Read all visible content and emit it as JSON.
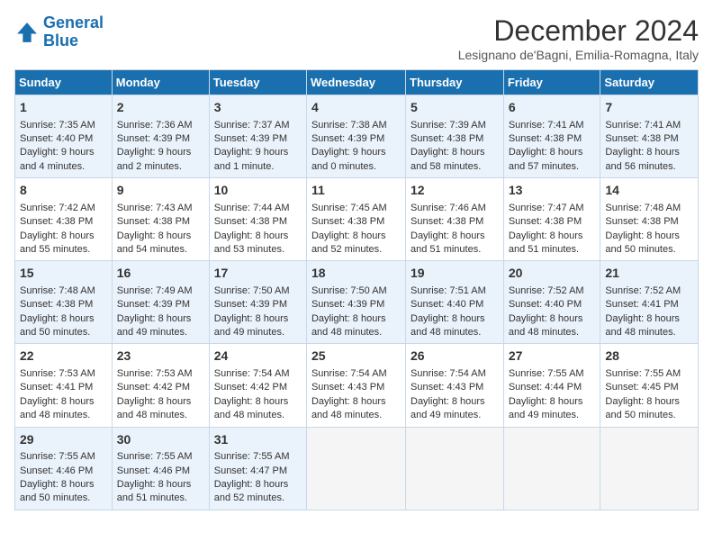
{
  "logo": {
    "line1": "General",
    "line2": "Blue"
  },
  "title": "December 2024",
  "subtitle": "Lesignano de'Bagni, Emilia-Romagna, Italy",
  "days_of_week": [
    "Sunday",
    "Monday",
    "Tuesday",
    "Wednesday",
    "Thursday",
    "Friday",
    "Saturday"
  ],
  "weeks": [
    [
      {
        "day": "1",
        "sunrise": "7:35 AM",
        "sunset": "4:40 PM",
        "daylight": "9 hours and 4 minutes."
      },
      {
        "day": "2",
        "sunrise": "7:36 AM",
        "sunset": "4:39 PM",
        "daylight": "9 hours and 2 minutes."
      },
      {
        "day": "3",
        "sunrise": "7:37 AM",
        "sunset": "4:39 PM",
        "daylight": "9 hours and 1 minute."
      },
      {
        "day": "4",
        "sunrise": "7:38 AM",
        "sunset": "4:39 PM",
        "daylight": "9 hours and 0 minutes."
      },
      {
        "day": "5",
        "sunrise": "7:39 AM",
        "sunset": "4:38 PM",
        "daylight": "8 hours and 58 minutes."
      },
      {
        "day": "6",
        "sunrise": "7:41 AM",
        "sunset": "4:38 PM",
        "daylight": "8 hours and 57 minutes."
      },
      {
        "day": "7",
        "sunrise": "7:41 AM",
        "sunset": "4:38 PM",
        "daylight": "8 hours and 56 minutes."
      }
    ],
    [
      {
        "day": "8",
        "sunrise": "7:42 AM",
        "sunset": "4:38 PM",
        "daylight": "8 hours and 55 minutes."
      },
      {
        "day": "9",
        "sunrise": "7:43 AM",
        "sunset": "4:38 PM",
        "daylight": "8 hours and 54 minutes."
      },
      {
        "day": "10",
        "sunrise": "7:44 AM",
        "sunset": "4:38 PM",
        "daylight": "8 hours and 53 minutes."
      },
      {
        "day": "11",
        "sunrise": "7:45 AM",
        "sunset": "4:38 PM",
        "daylight": "8 hours and 52 minutes."
      },
      {
        "day": "12",
        "sunrise": "7:46 AM",
        "sunset": "4:38 PM",
        "daylight": "8 hours and 51 minutes."
      },
      {
        "day": "13",
        "sunrise": "7:47 AM",
        "sunset": "4:38 PM",
        "daylight": "8 hours and 51 minutes."
      },
      {
        "day": "14",
        "sunrise": "7:48 AM",
        "sunset": "4:38 PM",
        "daylight": "8 hours and 50 minutes."
      }
    ],
    [
      {
        "day": "15",
        "sunrise": "7:48 AM",
        "sunset": "4:38 PM",
        "daylight": "8 hours and 50 minutes."
      },
      {
        "day": "16",
        "sunrise": "7:49 AM",
        "sunset": "4:39 PM",
        "daylight": "8 hours and 49 minutes."
      },
      {
        "day": "17",
        "sunrise": "7:50 AM",
        "sunset": "4:39 PM",
        "daylight": "8 hours and 49 minutes."
      },
      {
        "day": "18",
        "sunrise": "7:50 AM",
        "sunset": "4:39 PM",
        "daylight": "8 hours and 48 minutes."
      },
      {
        "day": "19",
        "sunrise": "7:51 AM",
        "sunset": "4:40 PM",
        "daylight": "8 hours and 48 minutes."
      },
      {
        "day": "20",
        "sunrise": "7:52 AM",
        "sunset": "4:40 PM",
        "daylight": "8 hours and 48 minutes."
      },
      {
        "day": "21",
        "sunrise": "7:52 AM",
        "sunset": "4:41 PM",
        "daylight": "8 hours and 48 minutes."
      }
    ],
    [
      {
        "day": "22",
        "sunrise": "7:53 AM",
        "sunset": "4:41 PM",
        "daylight": "8 hours and 48 minutes."
      },
      {
        "day": "23",
        "sunrise": "7:53 AM",
        "sunset": "4:42 PM",
        "daylight": "8 hours and 48 minutes."
      },
      {
        "day": "24",
        "sunrise": "7:54 AM",
        "sunset": "4:42 PM",
        "daylight": "8 hours and 48 minutes."
      },
      {
        "day": "25",
        "sunrise": "7:54 AM",
        "sunset": "4:43 PM",
        "daylight": "8 hours and 48 minutes."
      },
      {
        "day": "26",
        "sunrise": "7:54 AM",
        "sunset": "4:43 PM",
        "daylight": "8 hours and 49 minutes."
      },
      {
        "day": "27",
        "sunrise": "7:55 AM",
        "sunset": "4:44 PM",
        "daylight": "8 hours and 49 minutes."
      },
      {
        "day": "28",
        "sunrise": "7:55 AM",
        "sunset": "4:45 PM",
        "daylight": "8 hours and 50 minutes."
      }
    ],
    [
      {
        "day": "29",
        "sunrise": "7:55 AM",
        "sunset": "4:46 PM",
        "daylight": "8 hours and 50 minutes."
      },
      {
        "day": "30",
        "sunrise": "7:55 AM",
        "sunset": "4:46 PM",
        "daylight": "8 hours and 51 minutes."
      },
      {
        "day": "31",
        "sunrise": "7:55 AM",
        "sunset": "4:47 PM",
        "daylight": "8 hours and 52 minutes."
      },
      null,
      null,
      null,
      null
    ]
  ]
}
